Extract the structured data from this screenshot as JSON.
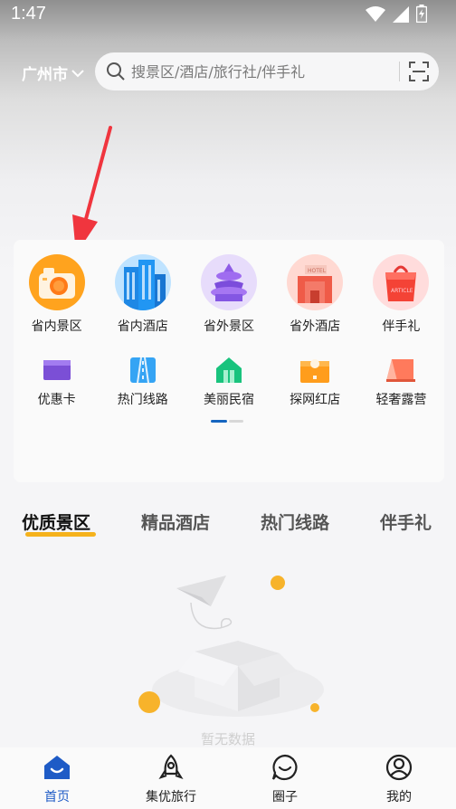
{
  "status_bar": {
    "time": "1:47"
  },
  "header": {
    "city": "广州市",
    "search_placeholder": "搜景区/酒店/旅行社/伴手礼"
  },
  "categories_row1": [
    {
      "label": "省内景区",
      "icon": "camera-icon"
    },
    {
      "label": "省内酒店",
      "icon": "buildings-icon"
    },
    {
      "label": "省外景区",
      "icon": "temple-icon"
    },
    {
      "label": "省外酒店",
      "icon": "hotel-icon"
    },
    {
      "label": "伴手礼",
      "icon": "gift-bag-icon"
    }
  ],
  "categories_row2": [
    {
      "label": "优惠卡",
      "icon": "card-icon"
    },
    {
      "label": "热门线路",
      "icon": "road-icon"
    },
    {
      "label": "美丽民宿",
      "icon": "house-icon"
    },
    {
      "label": "探网红店",
      "icon": "shop-icon"
    },
    {
      "label": "轻奢露营",
      "icon": "tent-icon"
    }
  ],
  "tabs": [
    {
      "label": "优质景区",
      "active": true
    },
    {
      "label": "精品酒店",
      "active": false
    },
    {
      "label": "热门线路",
      "active": false
    },
    {
      "label": "伴手礼",
      "active": false
    }
  ],
  "empty_state": {
    "text": "暂无数据"
  },
  "bottom_nav": [
    {
      "label": "首页",
      "icon": "home-icon",
      "active": true
    },
    {
      "label": "集优旅行",
      "icon": "rocket-icon",
      "active": false
    },
    {
      "label": "圈子",
      "icon": "chat-icon",
      "active": false
    },
    {
      "label": "我的",
      "icon": "user-icon",
      "active": false
    }
  ],
  "colors": {
    "accent": "#1e5bc6",
    "tab_underline": "#f5b21c",
    "arrow": "#f0353e"
  }
}
